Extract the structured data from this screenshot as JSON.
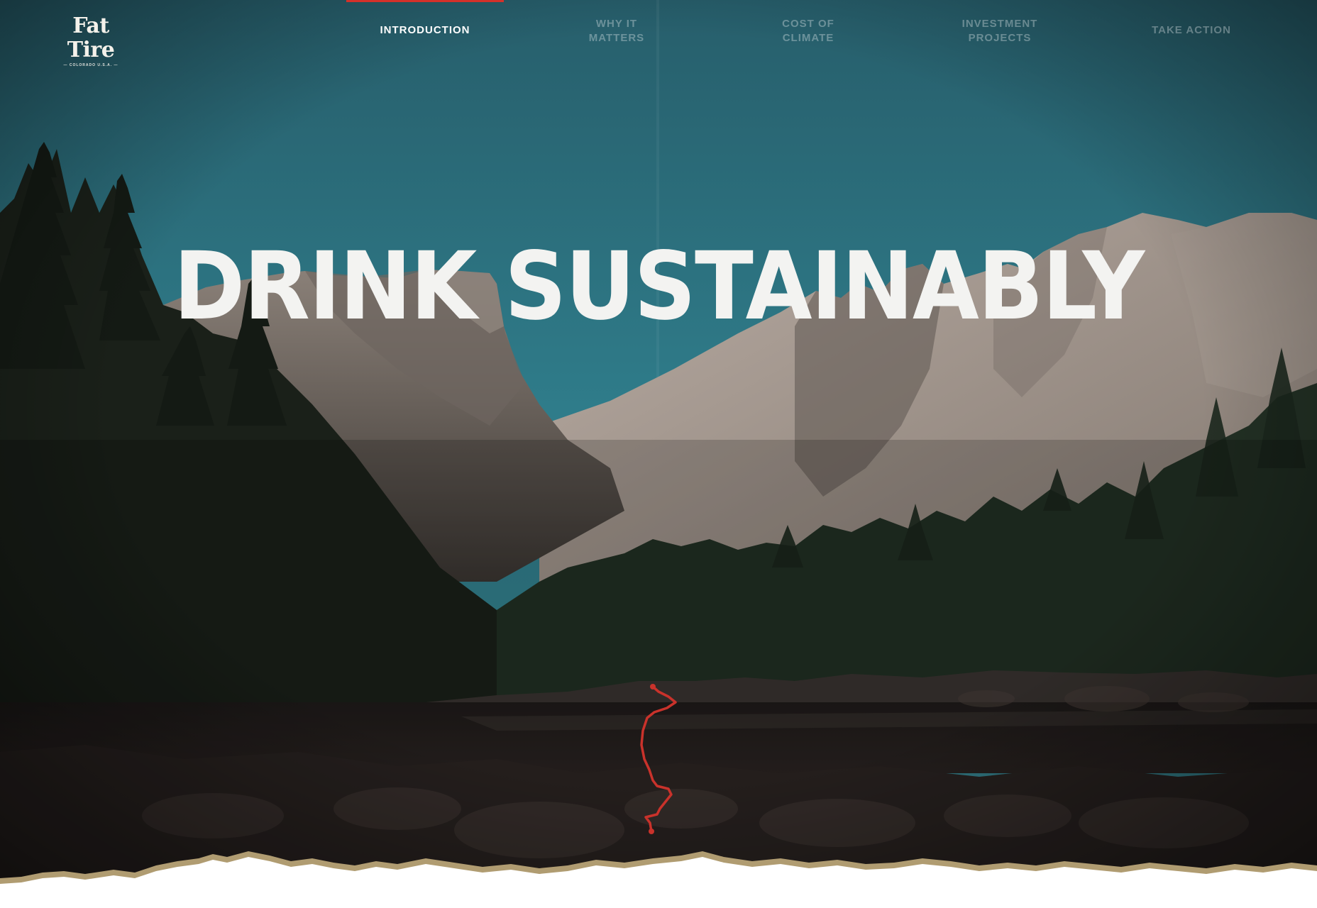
{
  "brand": {
    "name": "Fat Tire",
    "tagline": "— COLORADO U.S.A. —"
  },
  "nav": {
    "items": [
      {
        "label": "INTRODUCTION",
        "active": true
      },
      {
        "label": "WHY IT MATTERS",
        "active": false
      },
      {
        "label": "COST OF CLIMATE",
        "active": false
      },
      {
        "label": "INVESTMENT PROJECTS",
        "active": false
      },
      {
        "label": "TAKE ACTION",
        "active": false
      }
    ]
  },
  "hero": {
    "headline": "DRINK SUSTAINABLY",
    "background": "mountain-lake-photo",
    "trail_icon": "trail-route-line"
  },
  "colors": {
    "accent": "#d4312a",
    "sky": "#2f7d8c",
    "headline": "#f3f3f1",
    "paper": "#ffffff"
  }
}
